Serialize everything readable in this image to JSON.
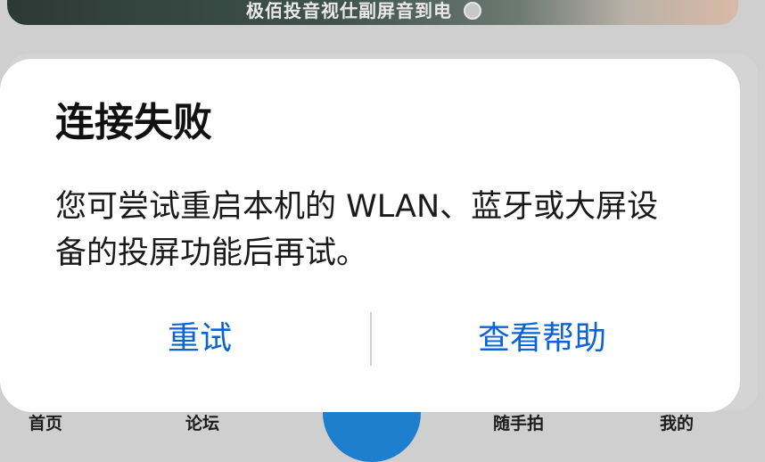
{
  "background": {
    "banner_text": "极佰投音视仕副屏音到电",
    "nav": {
      "home": "首页",
      "forum": "论坛",
      "snap": "随手拍",
      "mine": "我的"
    }
  },
  "dialog": {
    "title": "连接失败",
    "message": "您可尝试重启本机的 WLAN、蓝牙或大屏设备的投屏功能后再试。",
    "retry_label": "重试",
    "help_label": "查看帮助"
  },
  "colors": {
    "accent": "#0b63d6",
    "fab": "#1f7fcf"
  }
}
